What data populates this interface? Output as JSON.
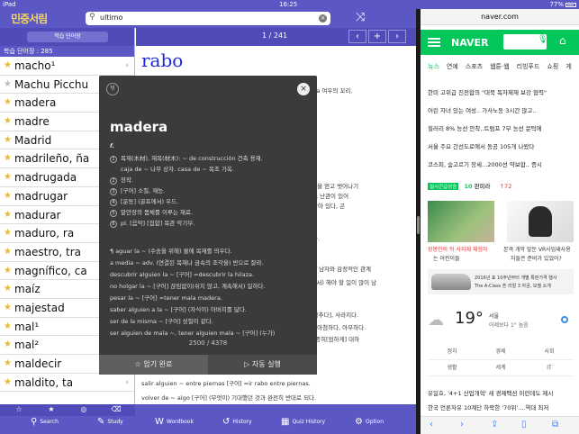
{
  "status": {
    "device": "iPad",
    "time": "16:25",
    "battery": "77%"
  },
  "dict": {
    "logo": "민중서림",
    "search_query": "ultimo",
    "wordbook_button": "학습 단어장",
    "wordbook_count": "학습 단어장 : 285",
    "words": [
      {
        "word": "macho¹",
        "starred": true
      },
      {
        "word": "Machu Picchu",
        "starred": false
      },
      {
        "word": "madera",
        "starred": true
      },
      {
        "word": "madre",
        "starred": true
      },
      {
        "word": "Madrid",
        "starred": true
      },
      {
        "word": "madrileño, ña",
        "starred": true
      },
      {
        "word": "madrugada",
        "starred": true
      },
      {
        "word": "madrugar",
        "starred": true
      },
      {
        "word": "madurar",
        "starred": true
      },
      {
        "word": "maduro, ra",
        "starred": true
      },
      {
        "word": "maestro, tra",
        "starred": true
      },
      {
        "word": "magnífico, ca",
        "starred": true
      },
      {
        "word": "maíz",
        "starred": true
      },
      {
        "word": "majestad",
        "starred": true
      },
      {
        "word": "mal¹",
        "starred": true
      },
      {
        "word": "mal²",
        "starred": true
      },
      {
        "word": "maldecir",
        "starred": true
      },
      {
        "word": "maldito, ta",
        "starred": true
      }
    ],
    "entry_counter": "1 / 241",
    "entry_headword": "rabo",
    "entry_background_lines": [
      "~ de zorra 여우의 꼬리.",
      "물건.",
      "하는 사람.",
      "] (어떤 이득을 얻고 벗어나기",
      "발하지 않다, 난관이 있어",
      "절이 아직 남아 있다, 곤",
      "처해 있다.",
      "다, 당혹하다.",
      "다.",
      "(여자가) 남자와 감정적인 관계",
      "려로부터(에서) 해야 할 일이 많이 남",
      "] 다니다.",
      "다[자취를 감추다], 사라지다.",
      "[살짝] 슬쩍 아첨하다, 아부하다.",
      "(누구를) 신중히[엄하게] 대하",
      "quedar el ~ por desollar [구어] =estar el rabo por desollar.",
      "a viento adv. (사냥꾼들이) 사냥감의 냄새를 맡으면서.",
      "salir alguien ~ entre piernas [구어] =ir rabo entre piernas.",
      "volver de ~ algo [구어] (무엇이) 기대했던 것과 완전히 반대로 되다."
    ],
    "popup": {
      "back_label": "뒤",
      "headword": "madera",
      "gender": "f.",
      "senses": [
        {
          "n": "1",
          "text": "목재(木材), 재목(材木): ~ de construcción 건축 용재."
        },
        {
          "n": "",
          "text": "caja de ~ 나무 상자. casa de ~ 목조 가옥."
        },
        {
          "n": "2",
          "text": "장작."
        },
        {
          "n": "3",
          "text": "[구어] 소질, 재능."
        },
        {
          "n": "4",
          "text": "[운동] (골프에서) 우드."
        },
        {
          "n": "5",
          "text": "말안장의 몸체를 이루는 재료."
        },
        {
          "n": "6",
          "text": "pl. [음악] [집합] 목관 악기부."
        }
      ],
      "idioms": [
        "¶ aguar la ~ (수송을 위해) 물에 목재를 띄우다.",
        "a media ~ adv. (연결된 목재나 금속의 조각을) 반으로 잘라.",
        "descubrir alguien la ~ [구어] =descubrir la hilaza.",
        "no holgar la ~ [구어] 끊임없이(쉬지 않고, 계속해서) 일하다.",
        "pesar la ~ [구어] =tener mala madera.",
        "saber alguien a la ~ [구어] (자식이) 아버지를 닮다.",
        "ser de la misma ~ [구어] 성질이 같다.",
        "ser alguien de mala ~, tener alguien mala ~ [구어] (누가)"
      ],
      "progress": "2500 / 4378",
      "memorize_label": "암기 완료",
      "autoplay_label": "자동 실행"
    },
    "tabs": [
      {
        "icon": "search-icon",
        "label": "Search"
      },
      {
        "icon": "study-icon",
        "label": "Study"
      },
      {
        "icon": "wordbook-icon",
        "label": "Wordbook"
      },
      {
        "icon": "history-icon",
        "label": "History"
      },
      {
        "icon": "quiz-history-icon",
        "label": "Quiz History"
      },
      {
        "icon": "option-icon",
        "label": "Option"
      }
    ]
  },
  "naver": {
    "url": "naver.com",
    "logo": "NAVER",
    "tabs": [
      "뉴스",
      "연예",
      "스포츠",
      "웹툰·웹",
      "리빙푸드",
      "쇼핑",
      "게"
    ],
    "news": [
      "한미 고위급 진전합의 \"대북 독자제재 보강 협력\"",
      "어린 자녀 있는 여성.. 가사노동 3시간 많고..",
      "힐러리 8% 능선 안착..트럼프 7부 능선 문턱에",
      "서울 주요 간선도로에서 동공 105개 나왔다",
      "코스피, 숨고르기 장세...2000선 약보합.. 증시"
    ],
    "realtime_badge": "실시간급상승",
    "realtime_rank": "10",
    "realtime_term": "판피라",
    "realtime_rank2": "↑72",
    "captions": [
      "장봉인의 뒤 사지체 체험하",
      "는 어린이들",
      "본격 개막 앞둔 VR사업새사용",
      "자들은 준비가 있었어?"
    ],
    "ad_text": "2016년 표 10주년부터 개별 특판가격 행사",
    "ad_sub": "The A-Class 흔 리얼 3 자금, 모델 소개",
    "weather": {
      "temp": "19°",
      "city": "서울",
      "desc": "어제보다 1° 높음"
    },
    "grid": [
      "정치",
      "경제",
      "사회",
      "생활",
      "세계",
      "IT"
    ],
    "bottom_news": [
      "유일호, '4+1 산업개혁' 새 경제팩션 이런데도 제시",
      "한국 언론자유 10계단 하락한 '70위'....역대 최저"
    ]
  }
}
